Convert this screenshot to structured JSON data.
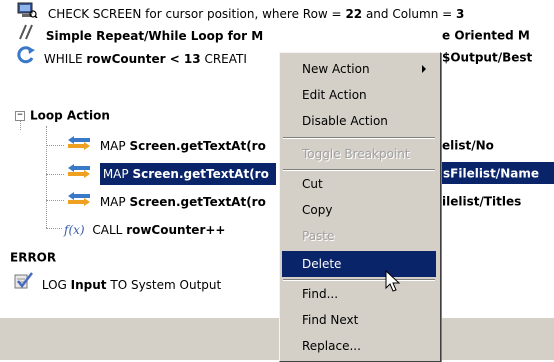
{
  "tree": {
    "check_screen": {
      "prefix": "CHECK SCREEN for cursor position, where Row = ",
      "row": "22",
      "mid": " and Column = ",
      "col": "3"
    },
    "comment": {
      "text": "Simple Repeat/While Loop for M",
      "tail": "e Oriented M"
    },
    "while": {
      "kw": "WHILE ",
      "cond": "rowCounter < 13",
      "rest": " CREATI",
      "tail": "$Output/Best"
    },
    "loop_action": {
      "label": "Loop Action"
    },
    "map1": {
      "kw": "MAP ",
      "call": "Screen.getTextAt(ro",
      "tail": "elist/No"
    },
    "map2": {
      "kw": "MAP ",
      "call": "Screen.getTextAt(ro",
      "tail": "sFilelist/Name"
    },
    "map3": {
      "kw": "MAP ",
      "call": "Screen.getTextAt(ro",
      "tail": "ilelist/Titles"
    },
    "call": {
      "kw": "CALL ",
      "name": "rowCounter++",
      "icon_text": "f(x)"
    },
    "error": {
      "label": "ERROR"
    },
    "log": {
      "kw": "LOG ",
      "what": "Input",
      "rest": " TO System Output"
    }
  },
  "context_menu": {
    "items": [
      {
        "label": "New Action",
        "enabled": true,
        "submenu": true
      },
      {
        "label": "Edit Action",
        "enabled": true
      },
      {
        "label": "Disable Action",
        "enabled": true
      },
      {
        "label": "Toggle Breakpoint",
        "enabled": false
      },
      {
        "label": "Cut",
        "enabled": true
      },
      {
        "label": "Copy",
        "enabled": true
      },
      {
        "label": "Paste",
        "enabled": false
      },
      {
        "label": "Delete",
        "enabled": true,
        "highlighted": true
      },
      {
        "label": "Find...",
        "enabled": true
      },
      {
        "label": "Find Next",
        "enabled": true
      },
      {
        "label": "Replace...",
        "enabled": true
      }
    ]
  },
  "colors": {
    "selection": "#0a246a",
    "menu_bg": "#d4d0c8",
    "arrow_blue": "#3a78c8",
    "arrow_orange": "#f0a020"
  }
}
